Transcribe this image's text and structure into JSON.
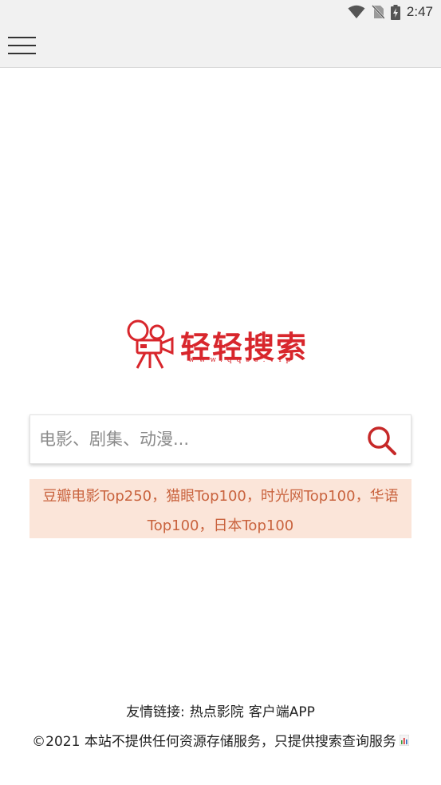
{
  "status_bar": {
    "time": "2:47",
    "icons": [
      "wifi-icon",
      "no-sim-icon",
      "battery-charging-icon"
    ]
  },
  "app_bar": {
    "menu_icon": "hamburger-menu-icon"
  },
  "logo": {
    "icon": "movie-camera-icon",
    "title": "轻轻搜索",
    "url": "www.qqss.vip",
    "color": "#d8262c"
  },
  "search": {
    "placeholder": "电影、剧集、动漫...",
    "value": "",
    "button_icon": "search-icon",
    "accent_color": "#c62828"
  },
  "top_lists": {
    "items": [
      "豆瓣电影Top250",
      "猫眼Top100",
      "时光网Top100",
      "华语Top100",
      "日本Top100"
    ],
    "separator": "，",
    "background": "#fbe5d9",
    "text_color": "#c9633e"
  },
  "footer": {
    "friend_links_label": "友情链接:",
    "friend_links": [
      "热点影院",
      "客户端APP"
    ],
    "copyright": "©2021 本站不提供任何资源存储服务，只提供搜索查询服务",
    "stats_icon": "statistics-badge-icon"
  }
}
